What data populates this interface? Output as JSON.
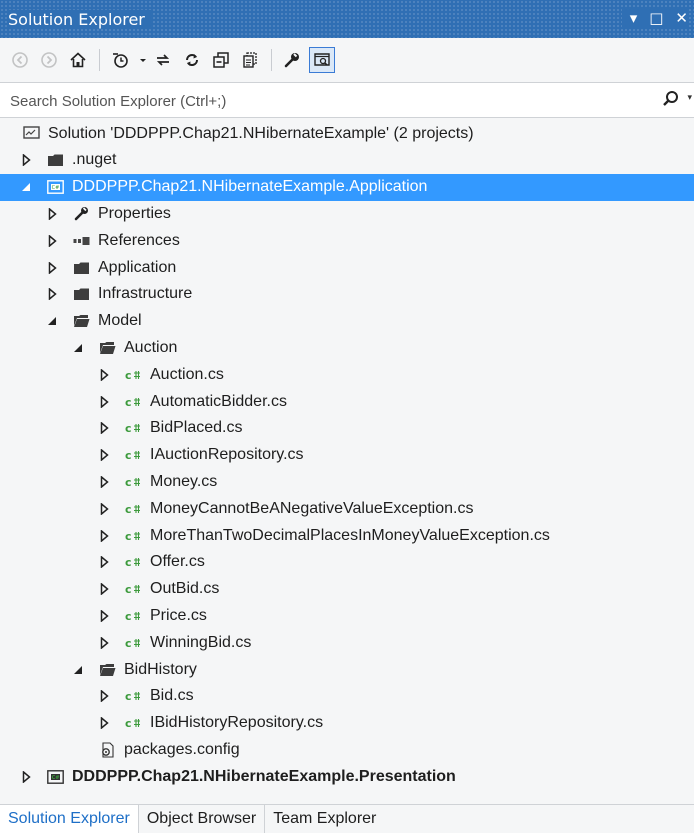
{
  "title": "Solution Explorer",
  "window_controls": [
    "▾",
    "□",
    "✕"
  ],
  "toolbar": {
    "items": [
      "back-icon",
      "forward-icon",
      "home-icon",
      "pending-changes-filter-icon",
      "dropdown-arrow-icon",
      "sync-with-active-document-icon",
      "refresh-icon",
      "collapse-all-icon",
      "show-all-files-icon",
      "properties-icon",
      "preview-selected-items-icon"
    ]
  },
  "search": {
    "placeholder": "Search Solution Explorer (Ctrl+;)"
  },
  "colors": {
    "titlebar": "#2f6fb4",
    "selection": "#3399ff",
    "cs_icon": "#3c9a3c",
    "folder": "#3d3d3d"
  },
  "tree": [
    {
      "label": "Solution 'DDDPPP.Chap21.NHibernateExample' (2 projects)",
      "icon": "solution-icon",
      "expander": "none",
      "level": 0,
      "name": "tree-item-solution"
    },
    {
      "label": ".nuget",
      "icon": "folder-icon",
      "expander": "collapsed",
      "level": 0,
      "name": "tree-item-nuget"
    },
    {
      "label": "DDDPPP.Chap21.NHibernateExample.Application",
      "icon": "csharp-project-icon",
      "expander": "expanded",
      "level": 0,
      "selected": true,
      "name": "tree-item-application-project"
    },
    {
      "label": "Properties",
      "icon": "wrench-icon",
      "expander": "collapsed",
      "level": 1,
      "name": "tree-item-properties"
    },
    {
      "label": "References",
      "icon": "references-icon",
      "expander": "collapsed",
      "level": 1,
      "name": "tree-item-references"
    },
    {
      "label": "Application",
      "icon": "folder-icon",
      "expander": "collapsed",
      "level": 1,
      "name": "tree-item-application-folder"
    },
    {
      "label": "Infrastructure",
      "icon": "folder-icon",
      "expander": "collapsed",
      "level": 1,
      "name": "tree-item-infrastructure"
    },
    {
      "label": "Model",
      "icon": "folder-open-icon",
      "expander": "expanded",
      "level": 1,
      "name": "tree-item-model"
    },
    {
      "label": "Auction",
      "icon": "folder-open-icon",
      "expander": "expanded",
      "level": 2,
      "name": "tree-item-auction-folder"
    },
    {
      "label": "Auction.cs",
      "icon": "csharp-file-icon",
      "expander": "collapsed",
      "level": 3,
      "name": "tree-item-file"
    },
    {
      "label": "AutomaticBidder.cs",
      "icon": "csharp-file-icon",
      "expander": "collapsed",
      "level": 3,
      "name": "tree-item-file"
    },
    {
      "label": "BidPlaced.cs",
      "icon": "csharp-file-icon",
      "expander": "collapsed",
      "level": 3,
      "name": "tree-item-file"
    },
    {
      "label": "IAuctionRepository.cs",
      "icon": "csharp-file-icon",
      "expander": "collapsed",
      "level": 3,
      "name": "tree-item-file"
    },
    {
      "label": "Money.cs",
      "icon": "csharp-file-icon",
      "expander": "collapsed",
      "level": 3,
      "name": "tree-item-file"
    },
    {
      "label": "MoneyCannotBeANegativeValueException.cs",
      "icon": "csharp-file-icon",
      "expander": "collapsed",
      "level": 3,
      "name": "tree-item-file"
    },
    {
      "label": "MoreThanTwoDecimalPlacesInMoneyValueException.cs",
      "icon": "csharp-file-icon",
      "expander": "collapsed",
      "level": 3,
      "name": "tree-item-file"
    },
    {
      "label": "Offer.cs",
      "icon": "csharp-file-icon",
      "expander": "collapsed",
      "level": 3,
      "name": "tree-item-file"
    },
    {
      "label": "OutBid.cs",
      "icon": "csharp-file-icon",
      "expander": "collapsed",
      "level": 3,
      "name": "tree-item-file"
    },
    {
      "label": "Price.cs",
      "icon": "csharp-file-icon",
      "expander": "collapsed",
      "level": 3,
      "name": "tree-item-file"
    },
    {
      "label": "WinningBid.cs",
      "icon": "csharp-file-icon",
      "expander": "collapsed",
      "level": 3,
      "name": "tree-item-file"
    },
    {
      "label": "BidHistory",
      "icon": "folder-open-icon",
      "expander": "expanded",
      "level": 2,
      "name": "tree-item-bidhistory-folder"
    },
    {
      "label": "Bid.cs",
      "icon": "csharp-file-icon",
      "expander": "collapsed",
      "level": 3,
      "name": "tree-item-file"
    },
    {
      "label": "IBidHistoryRepository.cs",
      "icon": "csharp-file-icon",
      "expander": "collapsed",
      "level": 3,
      "name": "tree-item-file"
    },
    {
      "label": "packages.config",
      "icon": "config-file-icon",
      "expander": "none",
      "level": 2,
      "name": "tree-item-packages-config"
    },
    {
      "label": "DDDPPP.Chap21.NHibernateExample.Presentation",
      "icon": "csharp-project-icon",
      "expander": "collapsed",
      "level": 0,
      "bold": true,
      "name": "tree-item-presentation-project"
    }
  ],
  "tabs": [
    {
      "label": "Solution Explorer",
      "active": true
    },
    {
      "label": "Object Browser",
      "active": false
    },
    {
      "label": "Team Explorer",
      "active": false
    }
  ]
}
